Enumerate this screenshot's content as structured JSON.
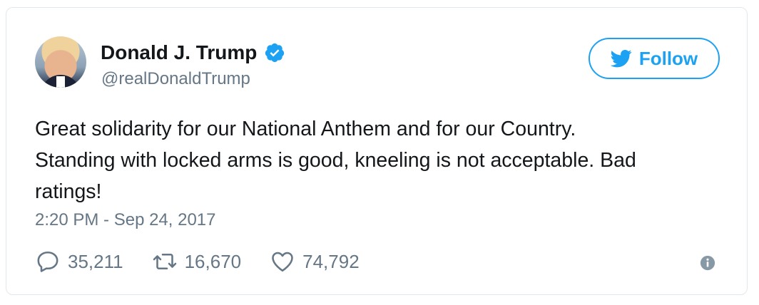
{
  "user": {
    "name": "Donald J. Trump",
    "handle": "@realDonaldTrump",
    "verified": true
  },
  "follow_button": {
    "label": "Follow"
  },
  "tweet": {
    "lines": [
      "Great solidarity for our National Anthem and for our Country.",
      "Standing with locked arms is good, kneeling is not acceptable. Bad",
      "ratings!"
    ],
    "timestamp": "2:20 PM - Sep 24, 2017"
  },
  "actions": {
    "replies": "35,211",
    "retweets": "16,670",
    "likes": "74,792"
  },
  "icons": {
    "verified": "verified-badge-icon",
    "follow": "twitter-bird-icon",
    "reply": "reply-icon",
    "retweet": "retweet-icon",
    "like": "heart-icon",
    "info": "info-icon"
  },
  "colors": {
    "brand": "#1da1f2",
    "text": "#14171a",
    "muted": "#657786",
    "border": "#e1e8ed"
  }
}
